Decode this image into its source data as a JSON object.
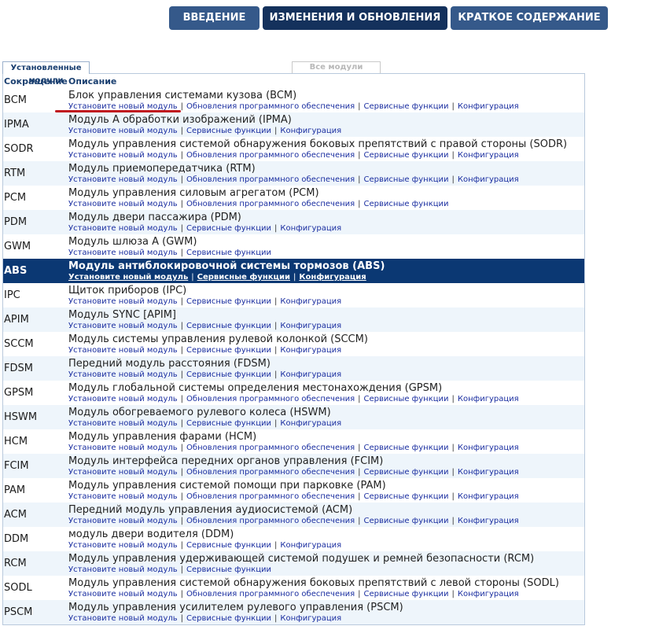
{
  "nav": {
    "buttons": [
      {
        "label": "ВВЕДЕНИЕ"
      },
      {
        "label": "ИЗМЕНЕНИЯ И ОБНОВЛЕНИЯ"
      },
      {
        "label": "КРАТКОЕ СОДЕРЖАНИЕ"
      }
    ],
    "active_index": 1
  },
  "tabs": {
    "installed": "Установленные модули",
    "all": "Все модули"
  },
  "table": {
    "headers": {
      "abbr": "Сокращение",
      "desc": "Описание"
    },
    "selected_index": 7,
    "rows": [
      {
        "abbr": "BCM",
        "title": "Блок управления системами кузова (BCM)",
        "links": [
          "Установите новый модуль",
          "Обновления программного обеспечения",
          "Сервисные функции",
          "Конфигурация"
        ]
      },
      {
        "abbr": "IPMA",
        "title": "Модуль A обработки изображений (IPMA)",
        "links": [
          "Установите новый модуль",
          "Сервисные функции",
          "Конфигурация"
        ]
      },
      {
        "abbr": "SODR",
        "title": "Модуль управления системой обнаружения боковых препятствий с правой стороны (SODR)",
        "links": [
          "Установите новый модуль",
          "Обновления программного обеспечения",
          "Сервисные функции",
          "Конфигурация"
        ]
      },
      {
        "abbr": "RTM",
        "title": "Модуль приемопередатчика (RTM)",
        "links": [
          "Установите новый модуль",
          "Обновления программного обеспечения",
          "Сервисные функции",
          "Конфигурация"
        ]
      },
      {
        "abbr": "PCM",
        "title": "Модуль управления силовым агрегатом (PCM)",
        "links": [
          "Установите новый модуль",
          "Обновления программного обеспечения",
          "Сервисные функции"
        ]
      },
      {
        "abbr": "PDM",
        "title": "Модуль двери пассажира (PDM)",
        "links": [
          "Установите новый модуль",
          "Сервисные функции",
          "Конфигурация"
        ]
      },
      {
        "abbr": "GWM",
        "title": "Модуль шлюза А (GWM)",
        "links": [
          "Установите новый модуль",
          "Сервисные функции"
        ]
      },
      {
        "abbr": "ABS",
        "title": "Модуль антиблокировочной системы тормозов (ABS)",
        "links": [
          "Установите новый модуль",
          "Сервисные функции",
          "Конфигурация"
        ]
      },
      {
        "abbr": "IPC",
        "title": "Щиток приборов (IPC)",
        "links": [
          "Установите новый модуль",
          "Сервисные функции",
          "Конфигурация"
        ]
      },
      {
        "abbr": "APIM",
        "title": "Модуль SYNC [APIM]",
        "links": [
          "Установите новый модуль",
          "Сервисные функции",
          "Конфигурация"
        ]
      },
      {
        "abbr": "SCCM",
        "title": "Модуль системы управления рулевой колонкой (SCCM)",
        "links": [
          "Установите новый модуль",
          "Сервисные функции",
          "Конфигурация"
        ]
      },
      {
        "abbr": "FDSM",
        "title": "Передний модуль расстояния (FDSM)",
        "links": [
          "Установите новый модуль",
          "Сервисные функции",
          "Конфигурация"
        ]
      },
      {
        "abbr": "GPSM",
        "title": "Модуль глобальной системы определения местонахождения (GPSM)",
        "links": [
          "Установите новый модуль",
          "Обновления программного обеспечения",
          "Сервисные функции",
          "Конфигурация"
        ]
      },
      {
        "abbr": "HSWM",
        "title": "Модуль обогреваемого рулевого колеса (HSWM)",
        "links": [
          "Установите новый модуль",
          "Сервисные функции",
          "Конфигурация"
        ]
      },
      {
        "abbr": "HCM",
        "title": "Модуль управления фарами (HCM)",
        "links": [
          "Установите новый модуль",
          "Обновления программного обеспечения",
          "Сервисные функции",
          "Конфигурация"
        ]
      },
      {
        "abbr": "FCIM",
        "title": "Модуль интерфейса передних органов управления (FCIM)",
        "links": [
          "Установите новый модуль",
          "Обновления программного обеспечения",
          "Сервисные функции",
          "Конфигурация"
        ]
      },
      {
        "abbr": "PAM",
        "title": "Модуль управления системой помощи при парковке (PAM)",
        "links": [
          "Установите новый модуль",
          "Обновления программного обеспечения",
          "Сервисные функции",
          "Конфигурация"
        ]
      },
      {
        "abbr": "ACM",
        "title": "Передний модуль управления аудиосистемой (ACM)",
        "links": [
          "Установите новый модуль",
          "Обновления программного обеспечения",
          "Сервисные функции",
          "Конфигурация"
        ]
      },
      {
        "abbr": "DDM",
        "title": "модуль двери водителя (DDM)",
        "links": [
          "Установите новый модуль",
          "Сервисные функции",
          "Конфигурация"
        ]
      },
      {
        "abbr": "RCM",
        "title": "Модуль управления удерживающей системой подушек и ремней безопасности (RCM)",
        "links": [
          "Установите новый модуль",
          "Сервисные функции"
        ]
      },
      {
        "abbr": "SODL",
        "title": "Модуль управления системой обнаружения боковых препятствий с левой стороны (SODL)",
        "links": [
          "Установите новый модуль",
          "Обновления программного обеспечения",
          "Сервисные функции",
          "Конфигурация"
        ]
      },
      {
        "abbr": "PSCM",
        "title": "Модуль управления усилителем рулевого управления (PSCM)",
        "links": [
          "Установите новый модуль",
          "Сервисные функции",
          "Конфигурация"
        ]
      }
    ]
  },
  "colors": {
    "nav_button": "#35598a",
    "nav_active": "#14315c",
    "selected_row": "#0b3873",
    "alt_row": "#eef5fb",
    "link": "#1a2ea0",
    "annotation": "#c0181f"
  }
}
